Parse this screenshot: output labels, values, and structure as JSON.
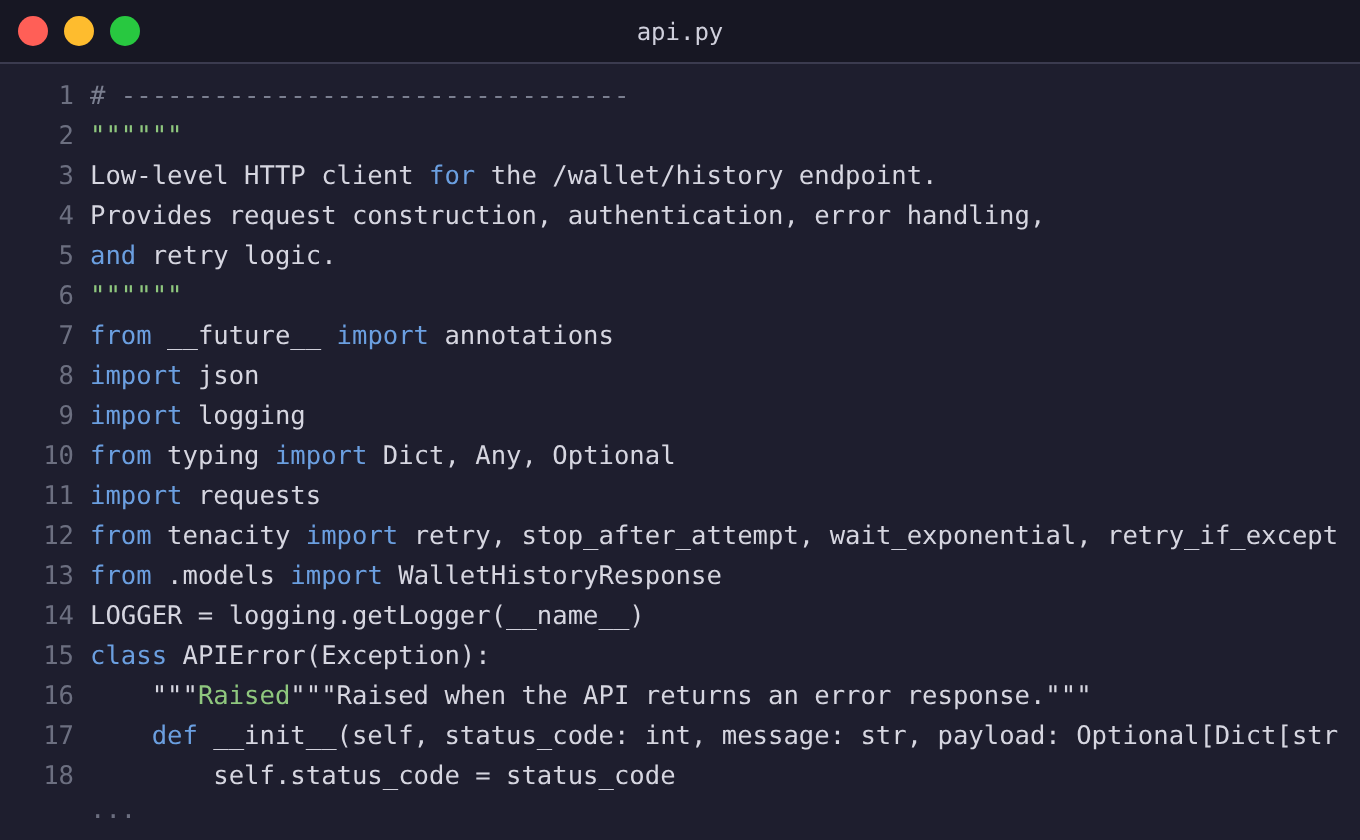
{
  "window": {
    "title": "api.py",
    "buttons": [
      {
        "color": "#ff5f57"
      },
      {
        "color": "#febc2e"
      },
      {
        "color": "#28c840"
      }
    ]
  },
  "lines": [
    {
      "number": "1",
      "tokens": [
        {
          "kind": "comment",
          "text": "# ---------------------------------"
        }
      ]
    },
    {
      "number": "2",
      "tokens": [
        {
          "kind": "string",
          "text": "\"\"\"\"\"\""
        }
      ]
    },
    {
      "number": "3",
      "tokens": [
        {
          "kind": "plain",
          "text": "Low-level HTTP client "
        },
        {
          "kind": "keyword",
          "text": "for"
        },
        {
          "kind": "plain",
          "text": " the /wallet/history endpoint."
        }
      ]
    },
    {
      "number": "4",
      "tokens": [
        {
          "kind": "plain",
          "text": "Provides request construction, authentication, error handling,"
        }
      ]
    },
    {
      "number": "5",
      "tokens": [
        {
          "kind": "keyword",
          "text": "and"
        },
        {
          "kind": "plain",
          "text": " retry logic."
        }
      ]
    },
    {
      "number": "6",
      "tokens": [
        {
          "kind": "string",
          "text": "\"\"\"\"\"\""
        }
      ]
    },
    {
      "number": "7",
      "tokens": [
        {
          "kind": "keyword",
          "text": "from"
        },
        {
          "kind": "plain",
          "text": " __future__ "
        },
        {
          "kind": "keyword",
          "text": "import"
        },
        {
          "kind": "plain",
          "text": " annotations"
        }
      ]
    },
    {
      "number": "8",
      "tokens": [
        {
          "kind": "keyword",
          "text": "import"
        },
        {
          "kind": "plain",
          "text": " json"
        }
      ]
    },
    {
      "number": "9",
      "tokens": [
        {
          "kind": "keyword",
          "text": "import"
        },
        {
          "kind": "plain",
          "text": " logging"
        }
      ]
    },
    {
      "number": "10",
      "tokens": [
        {
          "kind": "keyword",
          "text": "from"
        },
        {
          "kind": "plain",
          "text": " typing "
        },
        {
          "kind": "keyword",
          "text": "import"
        },
        {
          "kind": "plain",
          "text": " Dict, Any, Optional"
        }
      ]
    },
    {
      "number": "11",
      "tokens": [
        {
          "kind": "keyword",
          "text": "import"
        },
        {
          "kind": "plain",
          "text": " requests"
        }
      ]
    },
    {
      "number": "12",
      "tokens": [
        {
          "kind": "keyword",
          "text": "from"
        },
        {
          "kind": "plain",
          "text": " tenacity "
        },
        {
          "kind": "keyword",
          "text": "import"
        },
        {
          "kind": "plain",
          "text": " retry, stop_after_attempt, wait_exponential, retry_if_except"
        }
      ]
    },
    {
      "number": "13",
      "tokens": [
        {
          "kind": "keyword",
          "text": "from"
        },
        {
          "kind": "plain",
          "text": " .models "
        },
        {
          "kind": "keyword",
          "text": "import"
        },
        {
          "kind": "plain",
          "text": " WalletHistoryResponse"
        }
      ]
    },
    {
      "number": "14",
      "tokens": [
        {
          "kind": "plain",
          "text": "LOGGER = logging.getLogger(__name__)"
        }
      ]
    },
    {
      "number": "15",
      "tokens": [
        {
          "kind": "keyword",
          "text": "class"
        },
        {
          "kind": "plain",
          "text": " APIError(Exception):"
        }
      ],
      "children": [
        {
          "number": "16",
          "tokens": [
            {
              "kind": "plain",
              "text": "\"\"\""
            },
            {
              "kind": "string",
              "text": "Raised"
            },
            {
              "kind": "plain",
              "text": "\"\"\"Raised when the API returns an error response.\"\"\""
            }
          ]
        },
        {
          "number": "17",
          "tokens": [
            {
              "kind": "keyword",
              "text": "def"
            },
            {
              "kind": "plain",
              "text": " __init__(self, status_code: int, message: str, payload: Optional[Dict[str"
            }
          ],
          "children": [
            {
              "number": "18",
              "tokens": [
                {
                  "kind": "plain",
                  "text": "self.status_code = status_code"
                }
              ]
            }
          ]
        }
      ]
    }
  ],
  "more": "..."
}
